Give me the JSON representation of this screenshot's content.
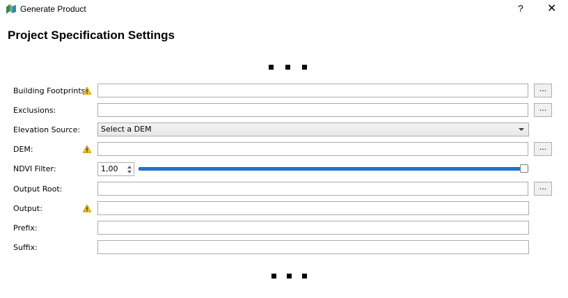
{
  "window": {
    "title": "Generate Product",
    "help_label": "?",
    "close_label": "✕"
  },
  "heading": "Project Specification Settings",
  "rows": {
    "building_footprints": {
      "label": "Building Footprints:",
      "value": "",
      "browse": "...",
      "warning": true
    },
    "exclusions": {
      "label": "Exclusions:",
      "value": "",
      "browse": "..."
    },
    "elevation_source": {
      "label": "Elevation Source:",
      "selected": "Select a DEM"
    },
    "dem": {
      "label": "DEM:",
      "value": "",
      "browse": "...",
      "warning": true
    },
    "ndvi_filter": {
      "label": "NDVI Filter:",
      "value": "1,00",
      "slider_level": 1.0
    },
    "output_root": {
      "label": "Output Root:",
      "value": "",
      "browse": "..."
    },
    "output": {
      "label": "Output:",
      "value": "",
      "warning": true
    },
    "prefix": {
      "label": "Prefix:",
      "value": ""
    },
    "suffix": {
      "label": "Suffix:",
      "value": ""
    }
  },
  "colors": {
    "slider_fill": "#1e7ad3",
    "warning": "#f0c419"
  }
}
